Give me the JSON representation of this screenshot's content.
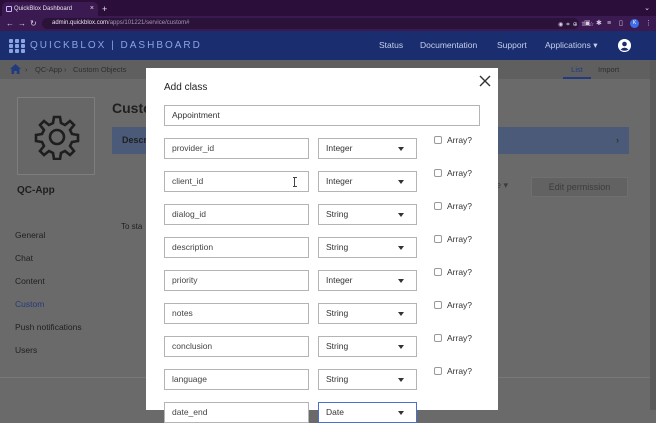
{
  "browser": {
    "tab_title": "QuickBlox Dashboard",
    "tab_close": "×",
    "new_tab": "+",
    "chevron": "⌄",
    "url_host": "admin.quickblox.com",
    "url_path": "/apps/101221/service/custom#",
    "profile_initial": "K"
  },
  "header": {
    "brand_left": "QUICKBLOX",
    "brand_sep": "|",
    "brand_right": "DASHBOARD",
    "nav": [
      "Status",
      "Documentation",
      "Support",
      "Applications ▾"
    ]
  },
  "breadcrumb": {
    "items": [
      "QC-App",
      "Custom Objects"
    ],
    "tabs": {
      "list": "List",
      "import": "Import"
    }
  },
  "sidebar": {
    "app_name": "QC-App",
    "items": [
      "General",
      "Chat",
      "Content",
      "Custom",
      "Push notifications",
      "Users"
    ],
    "active": "Custom"
  },
  "background": {
    "title": "Custo",
    "desc_label": "Descr",
    "more_label": "e ▾",
    "edit_permission": "Edit permission",
    "to_start": "To sta"
  },
  "modal": {
    "title": "Add class",
    "class_name_value": "Appointment",
    "array_label": "Array?",
    "rows": [
      {
        "field": "provider_id",
        "type": "Integer"
      },
      {
        "field": "client_id",
        "type": "Integer"
      },
      {
        "field": "dialog_id",
        "type": "String"
      },
      {
        "field": "description",
        "type": "String"
      },
      {
        "field": "priority",
        "type": "Integer"
      },
      {
        "field": "notes",
        "type": "String"
      },
      {
        "field": "conclusion",
        "type": "String"
      },
      {
        "field": "language",
        "type": "String"
      },
      {
        "field": "date_end",
        "type": "Date"
      }
    ]
  },
  "colors": {
    "header_bg": "#1a2d6e",
    "accent": "#243a7e",
    "browser_bg": "#3b1a52"
  }
}
